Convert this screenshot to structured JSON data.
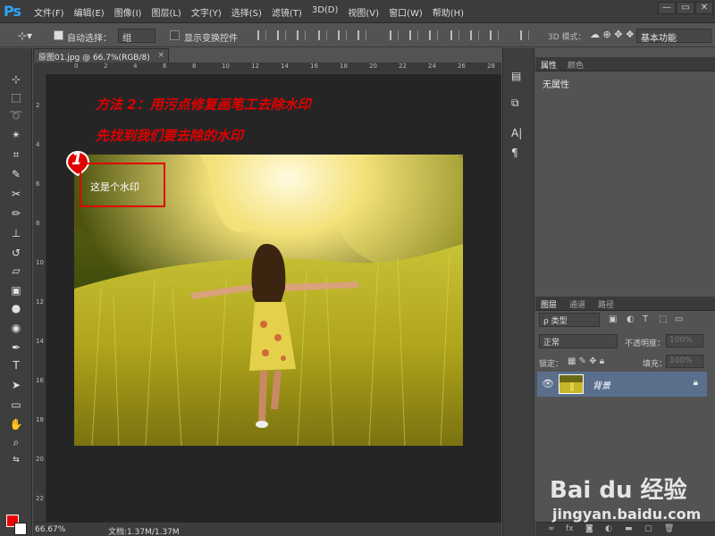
{
  "app": {
    "logo": "Ps"
  },
  "menu": [
    "文件(F)",
    "编辑(E)",
    "图像(I)",
    "图层(L)",
    "文字(Y)",
    "选择(S)",
    "滤镜(T)",
    "3D(D)",
    "视图(V)",
    "窗口(W)",
    "帮助(H)"
  ],
  "window_controls": {
    "minimize": "—",
    "maximize": "▭",
    "close": "✕"
  },
  "options": {
    "auto_select_label": "自动选择：",
    "auto_select_value": "组",
    "show_transform_label": "显示变换控件",
    "mode_3d_label": "3D 模式：",
    "workspace": "基本功能"
  },
  "document": {
    "tab_title": "原图01.jpg @ 66.7%(RGB/8)",
    "tab_close": "×",
    "instruction_1": "方法 2：用污点修复画笔工去除水印",
    "instruction_2": "先找到我们要去除的水印",
    "step_number": "1",
    "watermark_label": "这是个水印",
    "ruler_top": [
      "0",
      "2",
      "4",
      "6",
      "8",
      "10",
      "12",
      "14",
      "16",
      "18",
      "20",
      "22",
      "24",
      "26",
      "28"
    ],
    "ruler_left": [
      "2",
      "4",
      "6",
      "8",
      "10",
      "12",
      "14",
      "16",
      "18",
      "20",
      "22"
    ]
  },
  "status": {
    "zoom": "66.67%",
    "doc_size": "文档:1.37M/1.37M"
  },
  "properties_panel": {
    "tabs": [
      "属性",
      "颜色"
    ],
    "empty_text": "无属性"
  },
  "layers_panel": {
    "tabs": [
      "图层",
      "通道",
      "路径"
    ],
    "filter_label": "ρ 类型",
    "blend_mode": "正常",
    "opacity_label": "不透明度：",
    "opacity_value": "100%",
    "lock_label": "锁定：",
    "fill_label": "填充：",
    "fill_value": "100%",
    "layer_name": "背景"
  },
  "logo_watermark": {
    "brand": "Bai du 经验",
    "url": "jingyan.baidu.com"
  },
  "colors": {
    "foreground": "#ee0000",
    "background": "#ffffff",
    "instruction": "#e20000",
    "layer_selected": "#5a6f8c"
  }
}
